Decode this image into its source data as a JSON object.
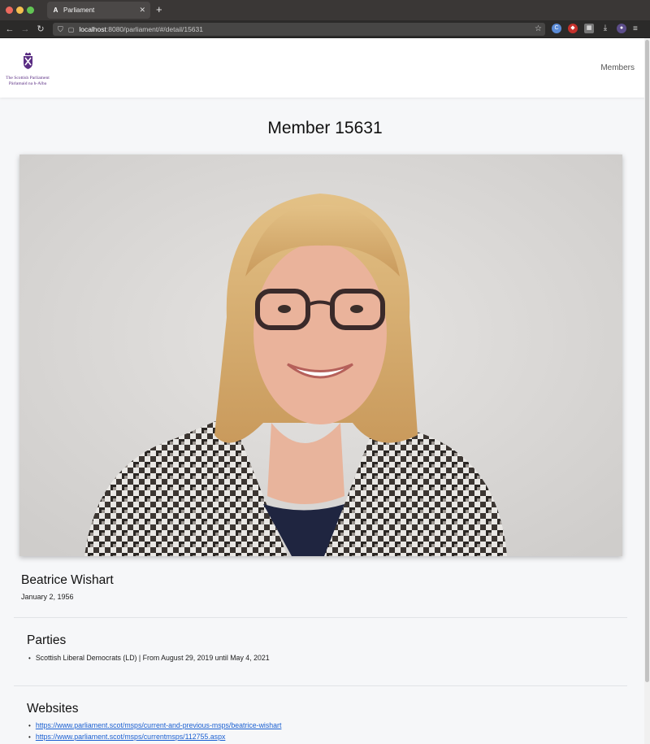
{
  "browser": {
    "tab_title": "Parliament",
    "tab_close": "✕",
    "new_tab": "+",
    "url_host": "localhost",
    "url_rest": ":8080/parliament/#/detail/15631"
  },
  "header": {
    "logo_line_1": "The Scottish Parliament",
    "logo_line_2": "Pàrlamaid na h-Alba",
    "nav_members": "Members"
  },
  "page": {
    "title": "Member 15631",
    "member_name": "Beatrice Wishart",
    "birth_date": "January 2, 1956"
  },
  "parties": {
    "heading": "Parties",
    "items": [
      "Scottish Liberal Democrats (LD) | From August 29, 2019 until May 4, 2021"
    ]
  },
  "websites": {
    "heading": "Websites",
    "links": [
      "https://www.parliament.scot/msps/current-and-previous-msps/beatrice-wishart",
      "https://www.parliament.scot/msps/currentmsps/112755.aspx"
    ]
  },
  "colors": {
    "logo_purple": "#5a2d83",
    "link_blue": "#1a5fd1"
  }
}
